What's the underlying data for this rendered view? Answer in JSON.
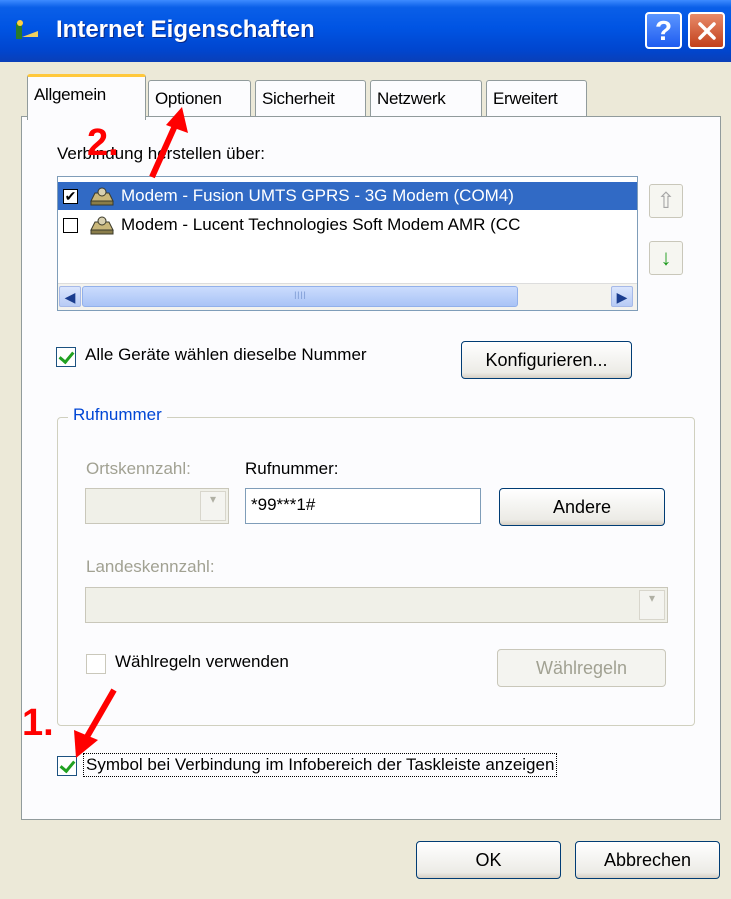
{
  "window": {
    "title": "Internet Eigenschaften",
    "help_label": "?",
    "close_label": "✕"
  },
  "tabs": [
    {
      "label": "Allgemein"
    },
    {
      "label": "Optionen"
    },
    {
      "label": "Sicherheit"
    },
    {
      "label": "Netzwerk"
    },
    {
      "label": "Erweitert"
    }
  ],
  "connect_via": {
    "label": "Verbindung herstellen über:",
    "items": [
      {
        "label": "Modem - Fusion UMTS GPRS - 3G Modem (COM4)",
        "checked": true,
        "selected": true
      },
      {
        "label": "Modem - Lucent Technologies Soft Modem AMR (CC",
        "checked": false,
        "selected": false
      }
    ],
    "scroll_grip": "IIII"
  },
  "side_buttons": {
    "up_icon": "⇧",
    "down_icon": "↓"
  },
  "all_devices": {
    "label": "Alle Geräte wählen dieselbe Nummer",
    "checked": true
  },
  "configure_button": "Konfigurieren...",
  "phone_group": {
    "title": "Rufnummer",
    "area_code_label": "Ortskennzahl:",
    "phone_label": "Rufnummer:",
    "phone_value": "*99***1#",
    "other_button": "Andere",
    "country_code_label": "Landeskennzahl:",
    "dialing_rules_label": "Wählregeln verwenden",
    "dialing_rules_checked": false,
    "dialing_rules_button": "Wählregeln"
  },
  "show_icon": {
    "label": "Symbol bei Verbindung im Infobereich der Taskleiste anzeigen",
    "checked": true
  },
  "footer": {
    "ok": "OK",
    "cancel": "Abbrechen"
  },
  "annotations": {
    "step1": "1.",
    "step2": "2.",
    "color": "#ff0000"
  }
}
